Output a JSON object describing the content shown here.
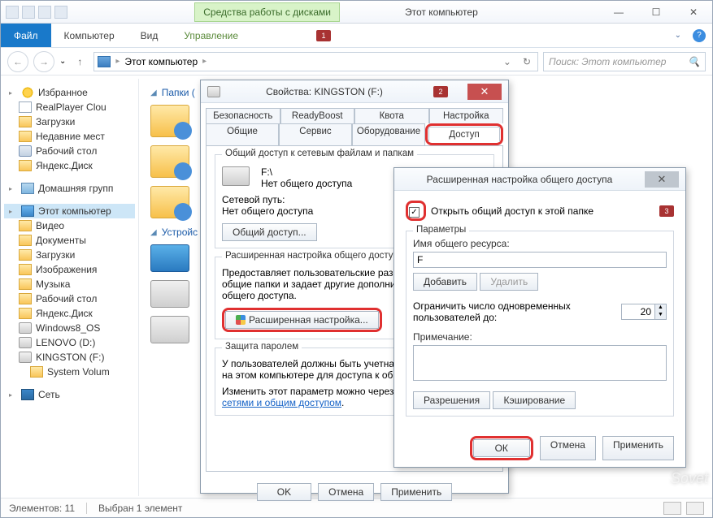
{
  "window": {
    "title": "Этот компьютер",
    "tool_tab": "Средства работы с дисками",
    "ribbon": {
      "file": "Файл",
      "computer": "Компьютер",
      "view": "Вид",
      "manage": "Управление"
    },
    "badge1": "1"
  },
  "nav": {
    "breadcrumb": "Этот компьютер",
    "search_placeholder": "Поиск: Этот компьютер"
  },
  "sidebar": {
    "favorites": "Избранное",
    "fav_items": [
      "RealPlayer Clou",
      "Загрузки",
      "Недавние мест",
      "Рабочий стол",
      "Яндекс.Диск"
    ],
    "homegroup": "Домашняя групп",
    "this_pc": "Этот компьютер",
    "pc_items": [
      "Видео",
      "Документы",
      "Загрузки",
      "Изображения",
      "Музыка",
      "Рабочий стол",
      "Яндекс.Диск",
      "Windows8_OS",
      "LENOVO (D:)",
      "KINGSTON (F:)",
      "System Volum"
    ],
    "network": "Сеть"
  },
  "content": {
    "folders_header": "Папки (",
    "devices_header": "Устройс"
  },
  "status": {
    "count": "Элементов: 11",
    "selected": "Выбран 1 элемент"
  },
  "props": {
    "title": "Свойства: KINGSTON (F:)",
    "badge2": "2",
    "tabs_row1": [
      "Безопасность",
      "ReadyBoost",
      "Квота",
      "Настройка"
    ],
    "tabs_row2": [
      "Общие",
      "Сервис",
      "Оборудование",
      "Доступ"
    ],
    "share_group": "Общий доступ к сетевым файлам и папкам",
    "drive_path": "F:\\",
    "no_share": "Нет общего доступа",
    "net_path_label": "Сетевой путь:",
    "net_path_value": "Нет общего доступа",
    "share_btn": "Общий доступ...",
    "adv_group": "Расширенная настройка общего доступа",
    "adv_desc": "Предоставляет пользовательские разрешения, создает общие папки и задает другие дополнительные параметры общего доступа.",
    "adv_btn": "Расширенная настройка...",
    "pwd_group": "Защита паролем",
    "pwd_desc": "У пользователей должны быть учетная запись и пароль на этом компьютере для доступа к общим папкам.",
    "pwd_link_prefix": "Изменить этот параметр можно через ",
    "pwd_link": "Центр управления сетями и общим доступом",
    "ok": "OK",
    "cancel": "Отмена",
    "apply": "Применить"
  },
  "adv": {
    "title": "Расширенная настройка общего доступа",
    "badge3": "3",
    "open_share": "Открыть общий доступ к этой папке",
    "params": "Параметры",
    "name_label": "Имя общего ресурса:",
    "name_value": "F",
    "add": "Добавить",
    "remove": "Удалить",
    "limit_label": "Ограничить число одновременных пользователей до:",
    "limit_value": "20",
    "note_label": "Примечание:",
    "perms": "Разрешения",
    "cache": "Кэширование",
    "ok": "ОК",
    "cancel": "Отмена",
    "apply": "Применить"
  }
}
